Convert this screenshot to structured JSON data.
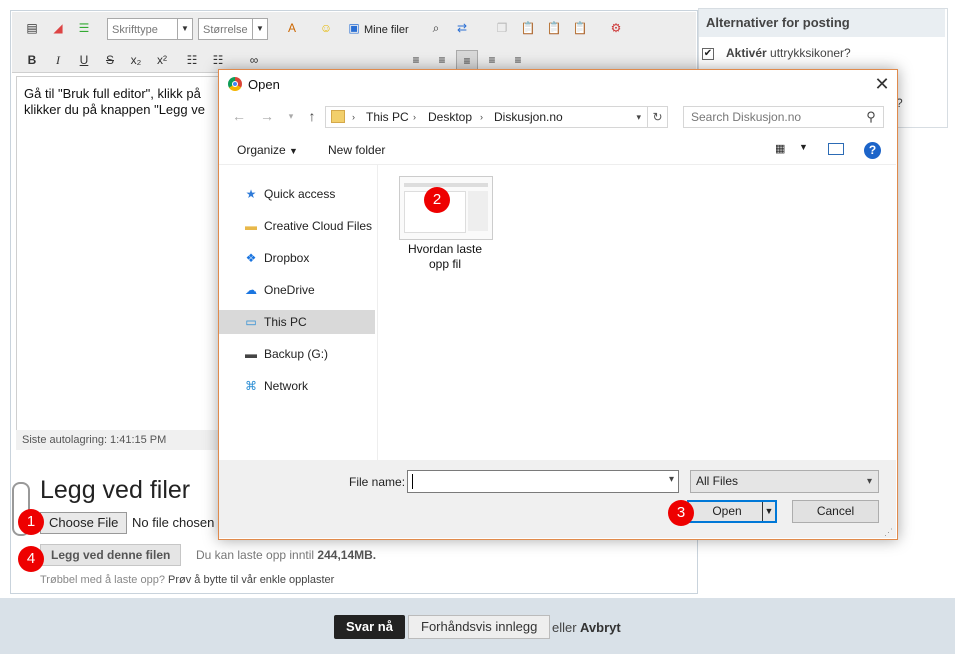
{
  "editor": {
    "text": "Gå til \"Bruk full editor\", klikk på ... klikker du på knappen \"Legg ve...",
    "line1": "Gå til \"Bruk full editor\", klikk på",
    "line2": "klikker du på knappen \"Legg ve",
    "font_select": "Skrifttype",
    "size_select": "Størrelse",
    "my_files": "Mine filer",
    "autosave": "Siste autolagring: 1:41:15 PM"
  },
  "attach": {
    "title": "Legg ved filer",
    "choose_file": "Choose File",
    "no_file": "No file chosen",
    "attach_button": "Legg ved denne filen",
    "limit_prefix": "Du kan laste opp inntil",
    "limit_value": "244,14MB.",
    "trouble": "Trøbbel med å laste opp?",
    "trouble_link": "Prøv å bytte til vår enkle opplaster"
  },
  "sidebar": {
    "title": "Alternativer for posting",
    "option_bold": "Aktivér",
    "option_rest": "uttrykksikoner?",
    "option_checked": true,
    "option2": "?"
  },
  "footer": {
    "reply": "Svar nå",
    "preview": "Forhåndsvis innlegg",
    "or": "eller",
    "cancel": "Avbryt"
  },
  "dialog": {
    "title": "Open",
    "path": [
      "This PC",
      "Desktop",
      "Diskusjon.no"
    ],
    "search_placeholder": "Search Diskusjon.no",
    "organize": "Organize",
    "new_folder": "New folder",
    "nav_items": [
      {
        "label": "Quick access",
        "icon": "star-icon",
        "color": "#2f7bd8"
      },
      {
        "label": "Creative Cloud Files",
        "icon": "folder-icon",
        "color": "#e8b84a"
      },
      {
        "label": "Dropbox",
        "icon": "dropbox-icon",
        "color": "#1a75e0"
      },
      {
        "label": "OneDrive",
        "icon": "cloud-icon",
        "color": "#1a75e0"
      },
      {
        "label": "This PC",
        "icon": "monitor-icon",
        "color": "#2a8dd4",
        "selected": true
      },
      {
        "label": "Backup (G:)",
        "icon": "drive-icon",
        "color": "#444444"
      },
      {
        "label": "Network",
        "icon": "network-icon",
        "color": "#2a8dd4"
      }
    ],
    "file": {
      "name": "Hvordan laste opp fil"
    },
    "file_name_label": "File name:",
    "file_name_value": "",
    "filter": "All Files",
    "open_button": "Open",
    "cancel_button": "Cancel"
  },
  "badges": [
    "1",
    "2",
    "3",
    "4"
  ],
  "colors": {
    "accent": "#0078d7",
    "badge": "#e00000",
    "dialog_border": "#e08a4c"
  }
}
